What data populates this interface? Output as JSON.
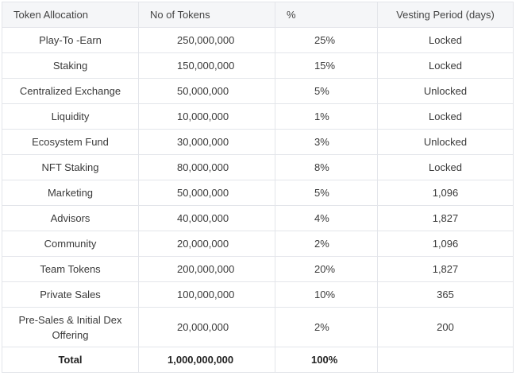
{
  "headers": [
    "Token Allocation",
    "No of Tokens",
    "%",
    "Vesting Period (days)"
  ],
  "rows": [
    {
      "allocation": "Play-To -Earn",
      "tokens": "250,000,000",
      "percent": "25%",
      "vesting": "Locked"
    },
    {
      "allocation": "Staking",
      "tokens": "150,000,000",
      "percent": "15%",
      "vesting": "Locked"
    },
    {
      "allocation": "Centralized Exchange",
      "tokens": "50,000,000",
      "percent": "5%",
      "vesting": "Unlocked"
    },
    {
      "allocation": "Liquidity",
      "tokens": "10,000,000",
      "percent": "1%",
      "vesting": "Locked"
    },
    {
      "allocation": "Ecosystem Fund",
      "tokens": "30,000,000",
      "percent": "3%",
      "vesting": "Unlocked"
    },
    {
      "allocation": "NFT Staking",
      "tokens": "80,000,000",
      "percent": "8%",
      "vesting": "Locked"
    },
    {
      "allocation": "Marketing",
      "tokens": "50,000,000",
      "percent": "5%",
      "vesting": "1,096"
    },
    {
      "allocation": "Advisors",
      "tokens": "40,000,000",
      "percent": "4%",
      "vesting": "1,827"
    },
    {
      "allocation": "Community",
      "tokens": "20,000,000",
      "percent": "2%",
      "vesting": "1,096"
    },
    {
      "allocation": "Team Tokens",
      "tokens": "200,000,000",
      "percent": "20%",
      "vesting": "1,827"
    },
    {
      "allocation": "Private Sales",
      "tokens": "100,000,000",
      "percent": "10%",
      "vesting": "365"
    },
    {
      "allocation": "Pre-Sales  & Initial Dex Offering",
      "tokens": "20,000,000",
      "percent": "2%",
      "vesting": "200"
    }
  ],
  "total": {
    "label": "Total",
    "tokens": "1,000,000,000",
    "percent": "100%",
    "vesting": ""
  }
}
